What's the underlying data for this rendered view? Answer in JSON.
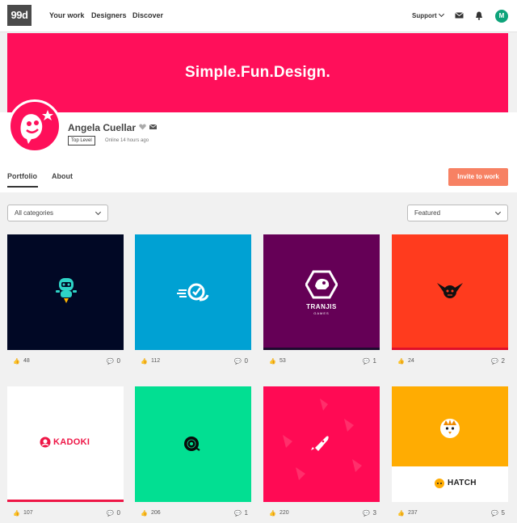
{
  "nav": {
    "logo": "99d",
    "links": [
      "Your work",
      "Designers",
      "Discover"
    ],
    "support": "Support",
    "user_initial": "M"
  },
  "banner": {
    "tagline": "Simple.Fun.Design."
  },
  "profile": {
    "name": "Angela Cuellar",
    "level": "Top Level",
    "status": "Online 14 hours ago"
  },
  "tabs": [
    "Portfolio",
    "About"
  ],
  "invite_label": "Invite to work",
  "filters": {
    "category": "All categories",
    "sort": "Featured"
  },
  "colors": {
    "brand_pink": "#ff0f5a",
    "invite": "#f78163",
    "avatar_green": "#0ea37a"
  },
  "portfolio": [
    {
      "likes": "48",
      "comments": "0",
      "bg": "#010825",
      "strip": "#010825",
      "text": ""
    },
    {
      "likes": "112",
      "comments": "0",
      "bg": "#00a1d3",
      "strip": "#00a1d3",
      "text": ""
    },
    {
      "likes": "53",
      "comments": "1",
      "bg": "#650056",
      "strip": "#1e0a2e",
      "text": "TRANJIS",
      "subtext": "GAMES"
    },
    {
      "likes": "24",
      "comments": "2",
      "bg": "#ff3b1e",
      "strip": "#e0102a",
      "text": ""
    },
    {
      "likes": "107",
      "comments": "0",
      "bg": "#ffffff",
      "strip": "#ee1646",
      "text": "KADOKI"
    },
    {
      "likes": "206",
      "comments": "1",
      "bg": "#02df92",
      "strip": "#02df92",
      "text": ""
    },
    {
      "likes": "220",
      "comments": "3",
      "bg": "#ff0a54",
      "strip": "#ff0a54",
      "text": ""
    },
    {
      "likes": "237",
      "comments": "5",
      "bg": "#ffac02",
      "strip": "#ffffff",
      "text": "HATCH"
    }
  ]
}
